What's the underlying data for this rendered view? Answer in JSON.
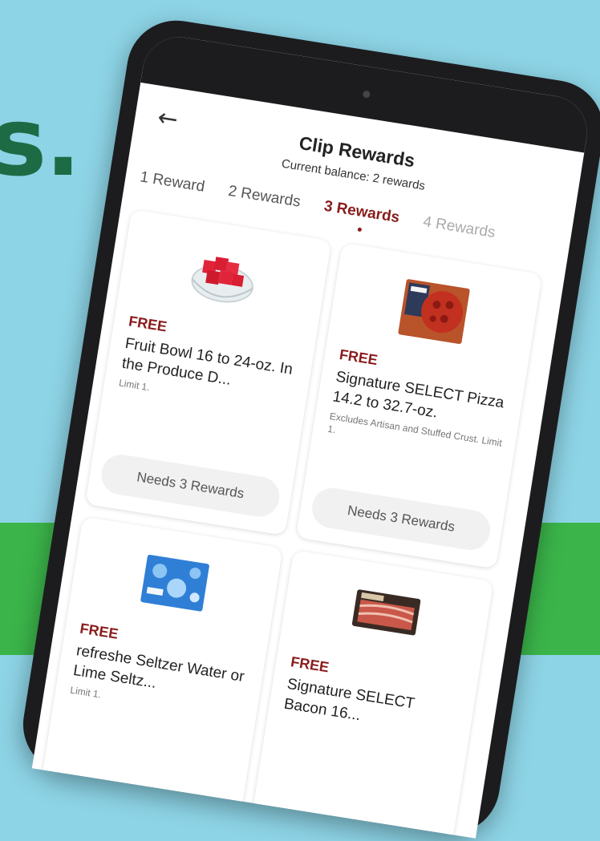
{
  "background": {
    "text": "s."
  },
  "header": {
    "back_icon": "←",
    "title": "Clip Rewards",
    "balance": "Current balance: 2 rewards"
  },
  "tabs": [
    {
      "label": "1 Reward",
      "active": false
    },
    {
      "label": "2 Rewards",
      "active": false
    },
    {
      "label": "3 Rewards",
      "active": true
    },
    {
      "label": "4 Rewards",
      "active": false
    }
  ],
  "offers": [
    {
      "badge": "FREE",
      "name": "Fruit Bowl 16 to 24-oz. In the Produce D...",
      "detail": "Limit 1.",
      "action": "Needs 3 Rewards",
      "icon": "watermelon-bowl-icon"
    },
    {
      "badge": "FREE",
      "name": "Signature SELECT Pizza 14.2 to 32.7-oz.",
      "detail": "Excludes Artisan and Stuffed Crust. Limit 1.",
      "action": "Needs 3 Rewards",
      "icon": "pizza-box-icon"
    },
    {
      "badge": "FREE",
      "name": "refreshe Seltzer Water or Lime Seltz...",
      "detail": "Limit 1.",
      "icon": "seltzer-pack-icon"
    },
    {
      "badge": "FREE",
      "name": "Signature SELECT Bacon 16...",
      "detail": "",
      "icon": "bacon-pack-icon"
    }
  ],
  "colors": {
    "accent": "#8a1c1c",
    "sky": "#8dd4e6",
    "band": "#3bb54a",
    "headline": "#1d6b45"
  }
}
